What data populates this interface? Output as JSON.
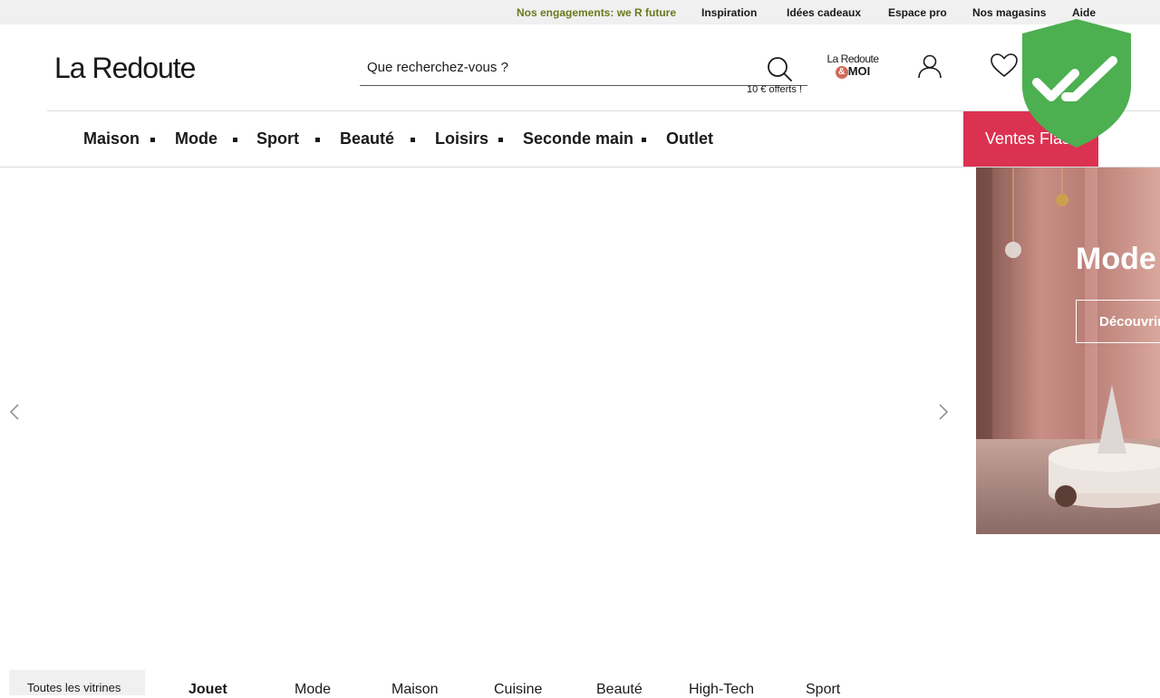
{
  "topbar": {
    "engagements": "Nos engagements: we R future",
    "inspiration": "Inspiration",
    "idees_cadeaux": "Idées cadeaux",
    "espace_pro": "Espace pro",
    "magasins": "Nos magasins",
    "aide": "Aide"
  },
  "header": {
    "logo": "La Redoute",
    "search_placeholder": "Que recherchez-vous ?",
    "offer": "10 € offerts !",
    "moi_line1": "La Redoute",
    "moi_amp": "&",
    "moi_line2": "MOI"
  },
  "nav": {
    "items": [
      "Maison",
      "Mode",
      "Sport",
      "Beauté",
      "Loisirs",
      "Seconde main",
      "Outlet"
    ],
    "flash": "Ventes Flash"
  },
  "slider": {
    "banner_title": "Mode",
    "banner_button": "Découvrir"
  },
  "bottom": {
    "vitrines": "Toutes les vitrines",
    "categories": [
      "Jouet",
      "Mode",
      "Maison",
      "Cuisine",
      "Beauté",
      "High-Tech",
      "Sport"
    ]
  },
  "colors": {
    "flash_red": "#dc3251",
    "badge_green": "#4caf50",
    "engagement_green": "#6a7a1d"
  },
  "icons": {
    "search": "search-icon",
    "account": "account-icon",
    "wishlist": "heart-icon",
    "trust_badge": "shield-check-icon",
    "prev": "chevron-left-icon",
    "next": "chevron-right-icon"
  }
}
